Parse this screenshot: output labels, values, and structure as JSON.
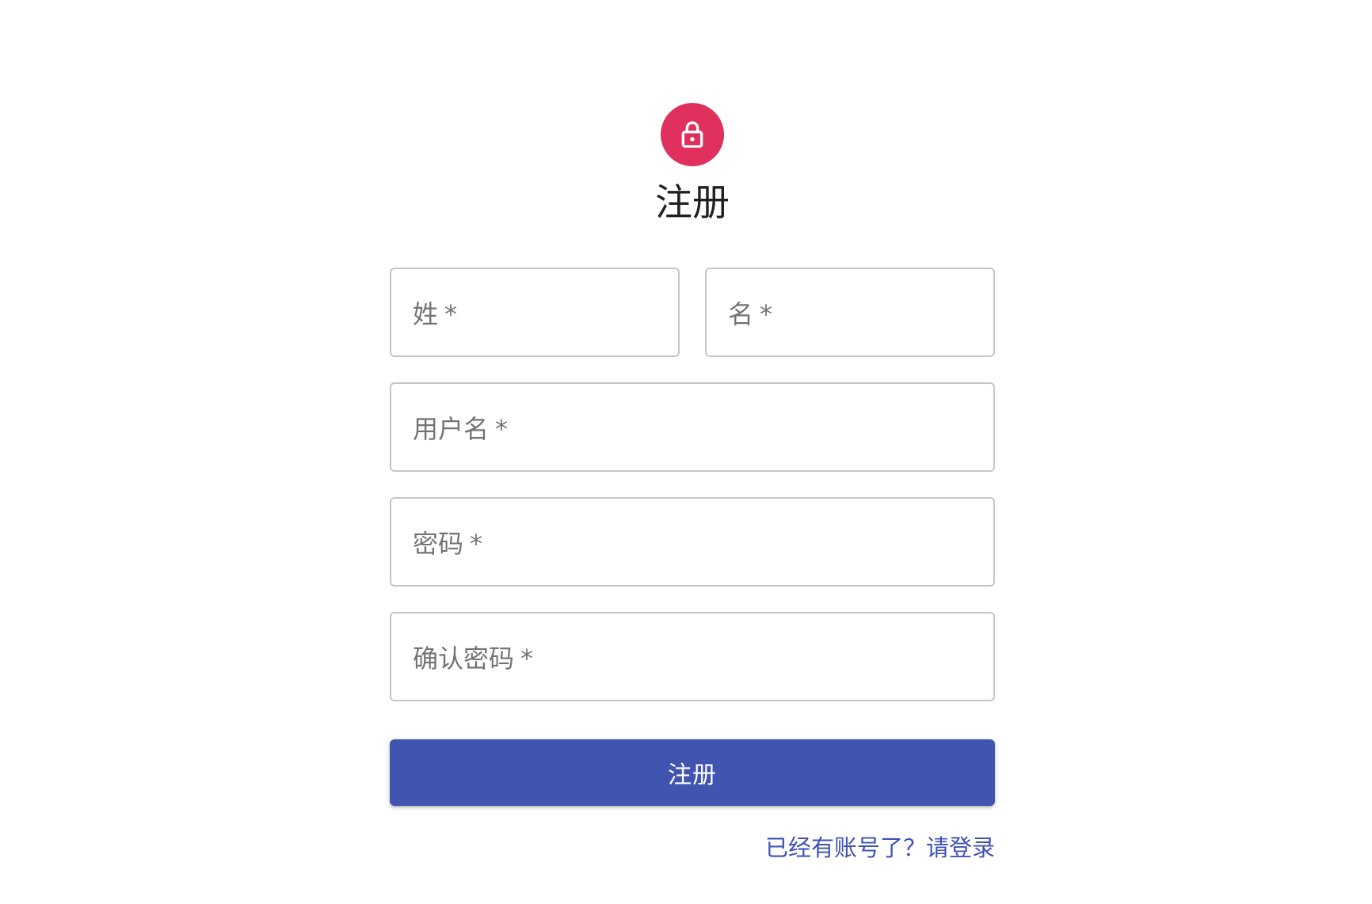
{
  "header": {
    "icon": "lock-icon",
    "avatar_color": "#e0305e",
    "title": "注册"
  },
  "form": {
    "last_name": {
      "label": "姓",
      "required_mark": "*"
    },
    "first_name": {
      "label": "名",
      "required_mark": "*"
    },
    "username": {
      "label": "用户名",
      "required_mark": "*"
    },
    "password": {
      "label": "密码",
      "required_mark": "*"
    },
    "confirm_password": {
      "label": "确认密码",
      "required_mark": "*"
    },
    "submit_label": "注册",
    "submit_color": "#4155b0"
  },
  "footer": {
    "login_link": "已经有账号了？请登录",
    "link_color": "#3f51b5"
  }
}
